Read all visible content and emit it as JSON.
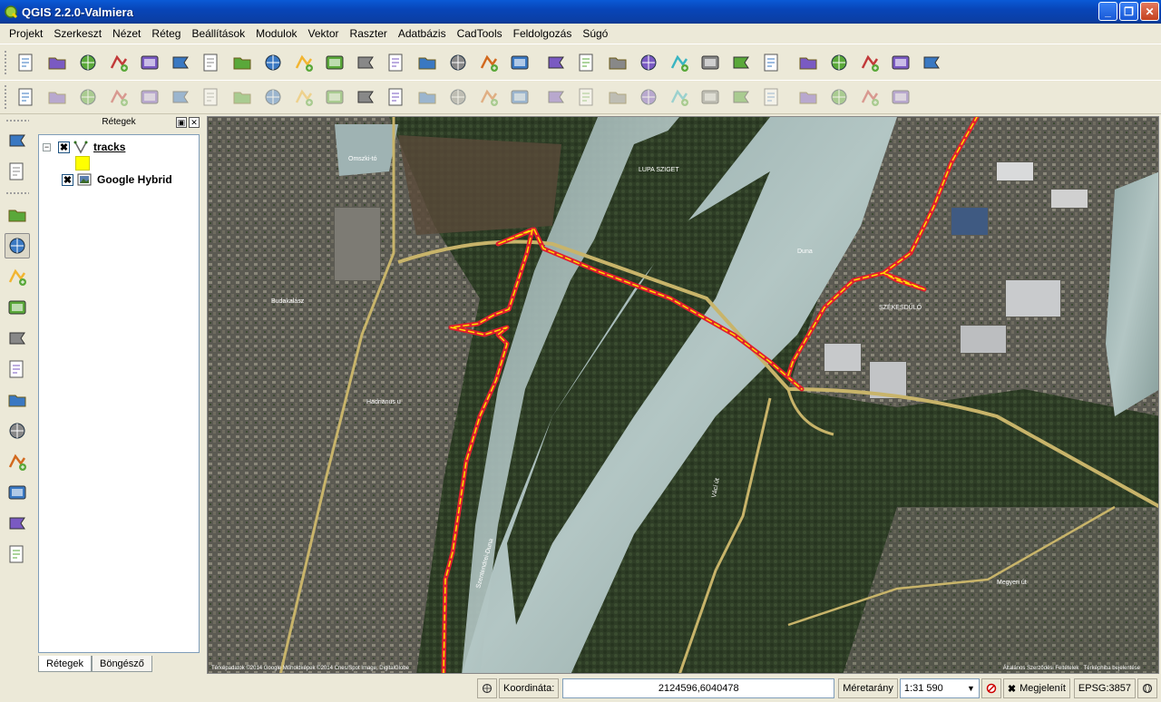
{
  "window": {
    "title": "QGIS 2.2.0-Valmiera"
  },
  "menu": [
    "Projekt",
    "Szerkeszt",
    "Nézet",
    "Réteg",
    "Beállítások",
    "Modulok",
    "Vektor",
    "Raszter",
    "Adatbázis",
    "CadTools",
    "Feldolgozás",
    "Súgó"
  ],
  "toolbar1": {
    "icons": [
      "new-project-icon",
      "open-project-icon",
      "save-project-icon",
      "save-as-icon",
      "new-print-composer-icon",
      "composer-manager-icon",
      "add-vector-layer-icon",
      "add-raster-layer-icon",
      "add-postgis-layer-icon",
      "add-spatialite-layer-icon",
      "add-mssql-layer-icon",
      "add-oracle-layer-icon",
      "add-wms-layer-icon",
      "add-wcs-layer-icon",
      "add-wfs-layer-icon",
      "add-delimited-text-icon",
      "new-shapefile-icon",
      "overflow-icon",
      "identify-icon",
      "select-icon",
      "select-feature-icon",
      "deselect-icon",
      "field-calculator-icon",
      "attribute-table-icon",
      "statistics-icon",
      "measure-icon",
      "annotation-icon",
      "new-text-annotation-icon",
      "text-annotation-icon",
      "label-icon"
    ]
  },
  "toolbar2": {
    "icons": [
      "cadtools-icon",
      "current-edits-icon",
      "toggle-editing-icon",
      "save-edits-icon",
      "add-feature-icon",
      "move-feature-icon",
      "node-tool-icon",
      "delete-selected-icon",
      "cut-features-icon",
      "copy-features-icon",
      "paste-features-icon",
      "help-icon",
      "whats-this-icon",
      "undo-icon",
      "redo-icon",
      "simplify-icon",
      "add-ring-icon",
      "add-part-icon",
      "fill-ring-icon",
      "delete-ring-icon",
      "delete-part-icon",
      "reshape-icon",
      "offset-curve-icon",
      "split-features-icon",
      "split-parts-icon",
      "merge-features-icon",
      "merge-attributes-icon",
      "rotate-symbols-icon",
      "rotate-label-icon"
    ]
  },
  "left_tools": [
    "pan-to-selection-icon",
    "map-tips-icon",
    "touch-zoom-icon",
    "pan-icon",
    "pan-map-icon",
    "zoom-in-icon",
    "zoom-out-icon",
    "zoom-native-icon",
    "zoom-full-icon",
    "zoom-selection-icon",
    "zoom-layer-icon",
    "zoom-last-icon",
    "zoom-next-icon",
    "refresh-icon"
  ],
  "layers_panel": {
    "title": "Rétegek",
    "layers": [
      {
        "name": "tracks",
        "checked": "✖",
        "color": "#ffff00"
      },
      {
        "name": "Google Hybrid",
        "checked": "✖"
      }
    ],
    "tabs": [
      "Rétegek",
      "Böngésző"
    ]
  },
  "map": {
    "attribution_left": "Térképadatok ©2014 Google Műholdképek ©2014 Cnes/Spot Image, DigitalGlobe",
    "attribution_right": "Általános Szerződési Feltételek · Térképhiba bejelentése",
    "track_color": "#e0202e",
    "track_dash_color": "#ffe000",
    "labels": [
      "Omszki-tó",
      "LUPA SZIGET",
      "SZÉKESDŰLŐ",
      "Hadrianus u",
      "Budakalász",
      "Duna",
      "Szentendrei-Duna",
      "Megyeri út",
      "Vácí út"
    ]
  },
  "statusbar": {
    "coord_label": "Koordináta:",
    "coord_value": "2124596,6040478",
    "scale_label": "Méretarány",
    "scale_value": "1:31 590",
    "render_label": "Megjelenít",
    "render_check": "✖",
    "crs": "EPSG:3857"
  }
}
